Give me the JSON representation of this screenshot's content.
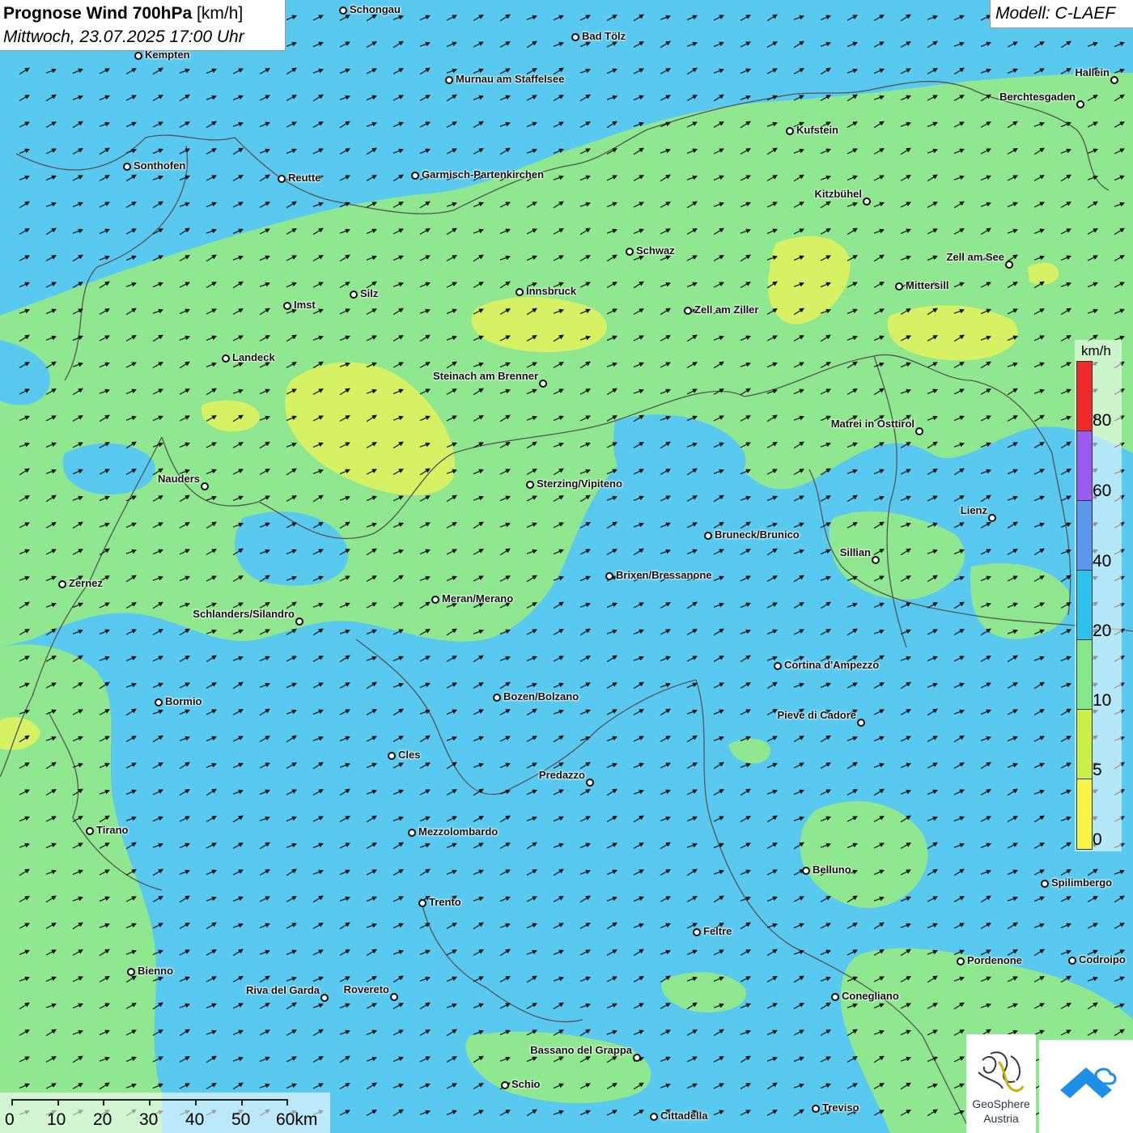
{
  "header": {
    "title": "Prognose Wind 700hPa",
    "unit": "[km/h]",
    "datetime": "Mittwoch, 23.07.2025 17:00 Uhr",
    "model": "Modell: C-LAEF"
  },
  "legend": {
    "unit": "km/h",
    "ticks": [
      "80",
      "60",
      "40",
      "20",
      "10",
      "5",
      "0"
    ],
    "colors": [
      "#f02828",
      "#9a5cf0",
      "#5a98f0",
      "#2ec3ef",
      "#86e88a",
      "#c8f048",
      "#f8f448"
    ]
  },
  "map_colors": {
    "speed_10_20": "#8fe88f",
    "speed_20_40": "#55c8f2",
    "speed_5_10": "#d6f264",
    "border": "#555555",
    "arrow": "#111111"
  },
  "cities": [
    {
      "name": "Schongau"
    },
    {
      "name": "Bad Tölz"
    },
    {
      "name": "Kempten"
    },
    {
      "name": "Hallein"
    },
    {
      "name": "Murnau am Staffelsee"
    },
    {
      "name": "Berchtesgaden"
    },
    {
      "name": "Kufstein"
    },
    {
      "name": "Sonthofen"
    },
    {
      "name": "Reutte"
    },
    {
      "name": "Garmisch-Partenkirchen"
    },
    {
      "name": "Kitzbühel"
    },
    {
      "name": "Schwaz"
    },
    {
      "name": "Zell am See"
    },
    {
      "name": "Mittersill"
    },
    {
      "name": "Innsbruck"
    },
    {
      "name": "Silz"
    },
    {
      "name": "Imst"
    },
    {
      "name": "Zell am Ziller"
    },
    {
      "name": "Landeck"
    },
    {
      "name": "Steinach am Brenner"
    },
    {
      "name": "Matrei in Osttirol"
    },
    {
      "name": "Nauders"
    },
    {
      "name": "Sterzing/Vipiteno"
    },
    {
      "name": "Lienz"
    },
    {
      "name": "Bruneck/Brunico"
    },
    {
      "name": "Sillian"
    },
    {
      "name": "Zernez"
    },
    {
      "name": "Brixen/Bressanone"
    },
    {
      "name": "Meran/Merano"
    },
    {
      "name": "Schlanders/Silandro"
    },
    {
      "name": "Cortina d'Ampezzo"
    },
    {
      "name": "Bozen/Bolzano"
    },
    {
      "name": "Bormio"
    },
    {
      "name": "Pieve di Cadore"
    },
    {
      "name": "Cles"
    },
    {
      "name": "Predazzo"
    },
    {
      "name": "Tirano"
    },
    {
      "name": "Mezzolombardo"
    },
    {
      "name": "Belluno"
    },
    {
      "name": "Spilimbergo"
    },
    {
      "name": "Trento"
    },
    {
      "name": "Feltre"
    },
    {
      "name": "Pordenone"
    },
    {
      "name": "Codroipo"
    },
    {
      "name": "Bienno"
    },
    {
      "name": "Riva del Garda"
    },
    {
      "name": "Rovereto"
    },
    {
      "name": "Conegliano"
    },
    {
      "name": "Bassano del Grappa"
    },
    {
      "name": "Schio"
    },
    {
      "name": "Treviso"
    },
    {
      "name": "Cittadella"
    }
  ],
  "scale": {
    "labels": [
      "0",
      "10",
      "20",
      "30",
      "40",
      "50",
      "60km"
    ]
  },
  "logos": {
    "geosphere_line1": "GeoSphere",
    "geosphere_line2": "Austria"
  },
  "wind": {
    "direction": "SW to NE"
  }
}
